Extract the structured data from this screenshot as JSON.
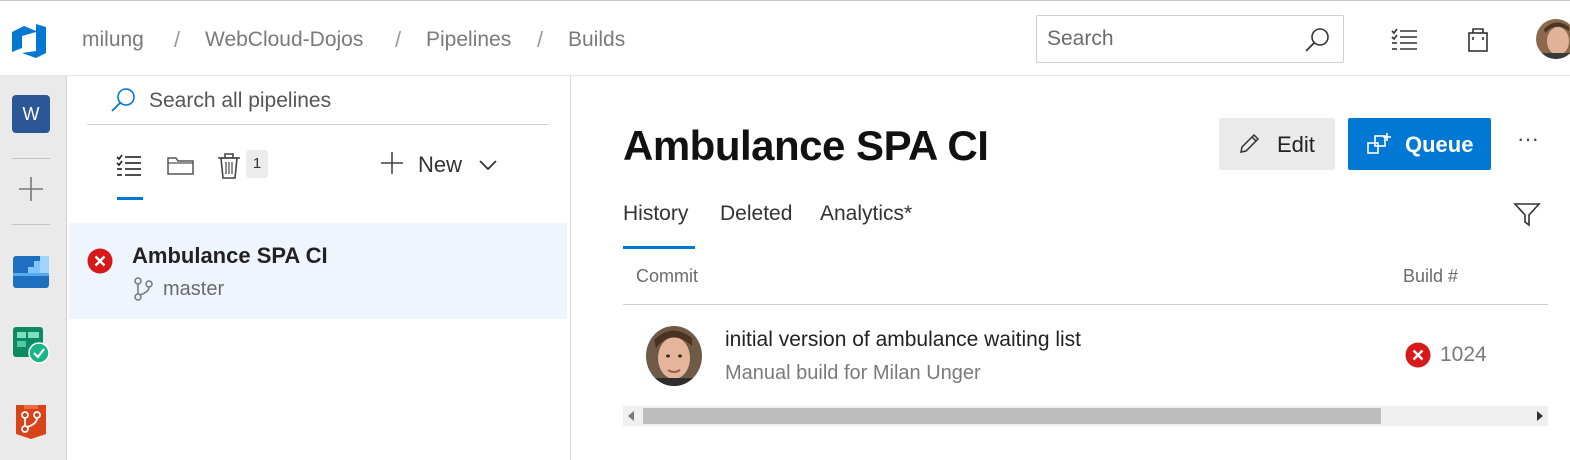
{
  "breadcrumb": {
    "items": [
      "milung",
      "WebCloud-Dojos",
      "Pipelines",
      "Builds"
    ],
    "separator": "/"
  },
  "header": {
    "search_placeholder": "Search",
    "icons": [
      "search-icon",
      "task-list-icon",
      "marketplace-bag-icon",
      "user-avatar"
    ]
  },
  "leftnav": {
    "org_initial": "W",
    "items": [
      "project-w",
      "add-icon",
      "boards-icon",
      "test-plans-icon",
      "repos-icon"
    ]
  },
  "pipelines_panel": {
    "search_placeholder": "Search all pipelines",
    "tabs": [
      "list-view-icon",
      "folder-view-icon",
      "deleted-icon"
    ],
    "deleted_count": "1",
    "new_label": "New",
    "items": [
      {
        "name": "Ambulance SPA CI",
        "branch": "master",
        "status": "failed"
      }
    ]
  },
  "main": {
    "title": "Ambulance SPA CI",
    "edit_label": "Edit",
    "queue_label": "Queue",
    "more_label": "···",
    "tabs": [
      "History",
      "Deleted",
      "Analytics*"
    ],
    "active_tab": "History",
    "columns": {
      "commit": "Commit",
      "build": "Build #"
    },
    "rows": [
      {
        "title": "initial version of ambulance waiting list",
        "subtitle": "Manual build for Milan Unger",
        "build_number": "1024",
        "status": "failed"
      }
    ]
  },
  "colors": {
    "accent": "#0078d4",
    "failure": "#d7191c",
    "selected_row": "#eef5fc",
    "nav_bg": "#eaeaea"
  }
}
